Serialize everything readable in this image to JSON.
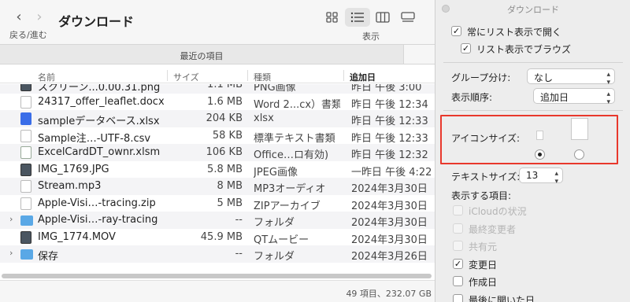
{
  "toolbar": {
    "back": "‹",
    "forward": "›",
    "nav_label": "戻る/進む",
    "title": "ダウンロード",
    "view_label": "表示"
  },
  "tabbar": {
    "label": "最近の項目"
  },
  "columns": {
    "name": "名前",
    "size": "サイズ",
    "kind": "種類",
    "date": "追加日"
  },
  "files": [
    {
      "name": "スクリーン...0.00.31.png",
      "size": "1.1 MB",
      "kind": "PNG画像",
      "date": "昨日 午後 3:00",
      "icon": "image-file-icon",
      "expandable": false
    },
    {
      "name": "24317_offer_leaflet.docx",
      "size": "1.6 MB",
      "kind": "Word 2...cx）書類",
      "date": "昨日 午後 12:34",
      "icon": "word-doc-icon",
      "expandable": false
    },
    {
      "name": "sampleデータベース.xlsx",
      "size": "204 KB",
      "kind": "xlsx",
      "date": "昨日 午後 12:33",
      "icon": "spreadsheet-icon",
      "expandable": false
    },
    {
      "name": "Sample注…-UTF-8.csv",
      "size": "58 KB",
      "kind": "標準テキスト書類",
      "date": "昨日 午後 12:33",
      "icon": "text-doc-icon",
      "expandable": false
    },
    {
      "name": "ExcelCardDT_ownr.xlsm",
      "size": "106 KB",
      "kind": "Office…ロ有効)",
      "date": "昨日 午後 12:32",
      "icon": "excel-macro-icon",
      "expandable": false
    },
    {
      "name": "IMG_1769.JPG",
      "size": "5.8 MB",
      "kind": "JPEG画像",
      "date": "一昨日 午後 4:22",
      "icon": "image-file-icon",
      "expandable": false
    },
    {
      "name": "Stream.mp3",
      "size": "8 MB",
      "kind": "MP3オーディオ",
      "date": "2024年3月30日",
      "icon": "audio-file-icon",
      "expandable": false
    },
    {
      "name": "Apple-Visi…-tracing.zip",
      "size": "5 MB",
      "kind": "ZIPアーカイブ",
      "date": "2024年3月30日",
      "icon": "zip-file-icon",
      "expandable": false
    },
    {
      "name": "Apple-Visi…-ray-tracing",
      "size": "--",
      "kind": "フォルダ",
      "date": "2024年3月30日",
      "icon": "folder-icon",
      "expandable": true
    },
    {
      "name": "IMG_1774.MOV",
      "size": "45.9 MB",
      "kind": "QTムービー",
      "date": "2024年3月30日",
      "icon": "movie-file-icon",
      "expandable": false
    },
    {
      "name": "保存",
      "size": "--",
      "kind": "フォルダ",
      "date": "2024年3月26日",
      "icon": "folder-icon",
      "expandable": true
    }
  ],
  "status": {
    "text": "49 項目、232.07 GB"
  },
  "panel": {
    "title": "ダウンロード",
    "always_list": "常にリスト表示で開く",
    "browse_list": "リスト表示でブラウズ",
    "group_label": "グループ分け:",
    "group_value": "なし",
    "sort_label": "表示順序:",
    "sort_value": "追加日",
    "icon_size_label": "アイコンサイズ:",
    "text_size_label": "テキストサイズ:",
    "text_size_value": "13",
    "show_items_label": "表示する項目:",
    "columns_opts": [
      {
        "label": "iCloudの状況",
        "checked": false,
        "disabled": true
      },
      {
        "label": "最終変更者",
        "checked": false,
        "disabled": true
      },
      {
        "label": "共有元",
        "checked": false,
        "disabled": true
      },
      {
        "label": "変更日",
        "checked": true,
        "disabled": false
      },
      {
        "label": "作成日",
        "checked": false,
        "disabled": false
      },
      {
        "label": "最後に開いた日",
        "checked": false,
        "disabled": false
      }
    ]
  }
}
